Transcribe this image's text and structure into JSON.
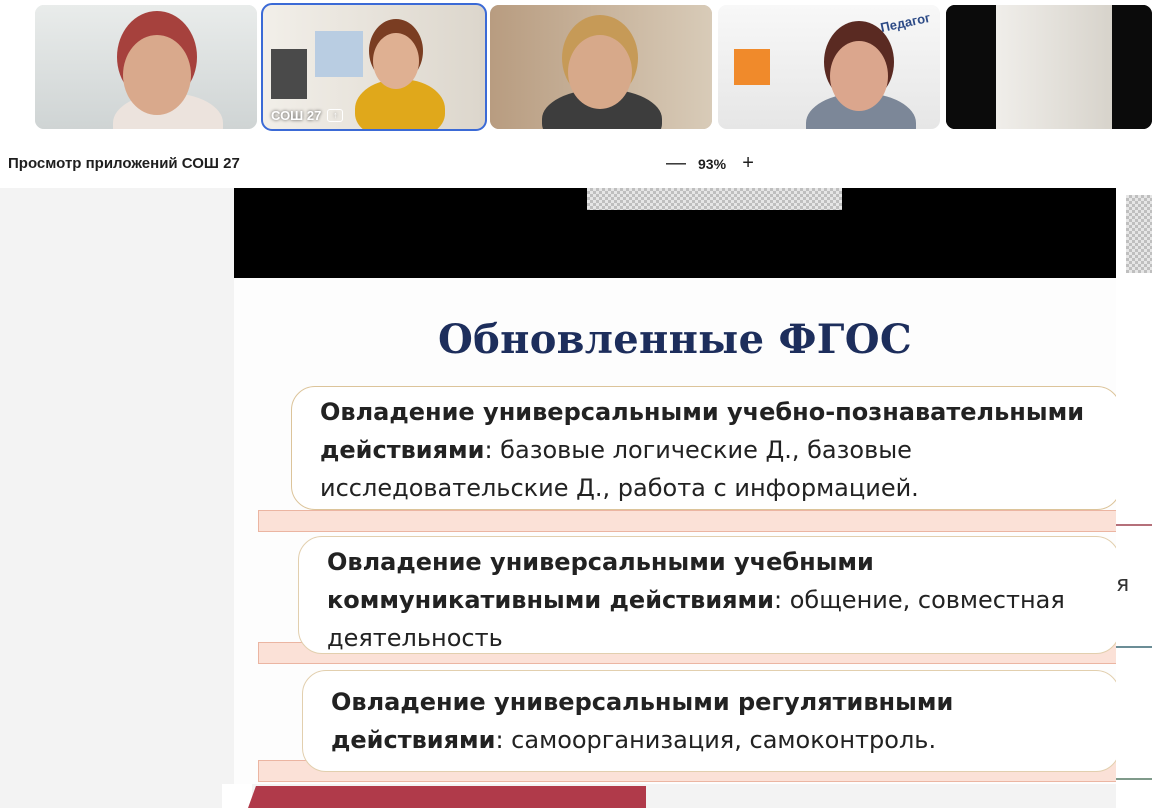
{
  "participants": [
    {
      "label": "",
      "active": false
    },
    {
      "label": "СОШ 27",
      "active": true
    },
    {
      "label": "",
      "active": false
    },
    {
      "label": "Педагог",
      "active": false
    },
    {
      "label": "",
      "active": false
    }
  ],
  "toolbar": {
    "title": "Просмотр приложений СОШ 27",
    "zoom_out": "—",
    "zoom_value": "93%",
    "zoom_in": "+"
  },
  "slide": {
    "title": "Обновленные ФГОС",
    "blocks": [
      {
        "bold": "Овладение универсальными учебно-познавательными действиями",
        "rest": ": базовые логические Д., базовые исследовательские Д., работа с информацией."
      },
      {
        "bold": "Овладение универсальными учебными коммуникативными действиями",
        "rest": ": общение, совместная деятельность"
      },
      {
        "bold": "Овладение универсальными регулятивными действиями",
        "rest": ": самоорганизация, самоконтроль."
      }
    ]
  },
  "right_fragment": "я",
  "colors": {
    "slide_title": "#1d2e5c",
    "active_tile": "#3b6ad6",
    "band": "#fbe1d7"
  }
}
